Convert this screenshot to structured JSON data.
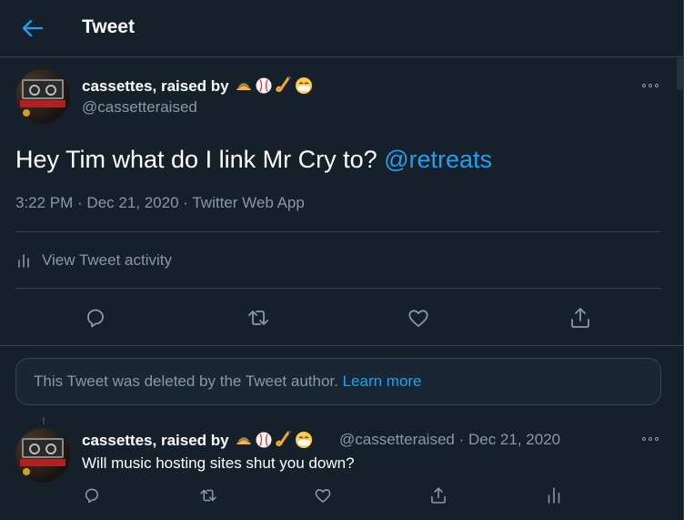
{
  "header": {
    "title": "Tweet"
  },
  "main_tweet": {
    "author_name": "cassettes, raised by",
    "author_emojis": [
      "taco-emoji",
      "baseball-emoji",
      "saxophone-emoji",
      "mask-face-emoji"
    ],
    "handle": "@cassetteraised",
    "text": "Hey Tim what do I link Mr Cry to? ",
    "mention": "@retreats",
    "meta": "3:22 PM · Dec 21, 2020 · Twitter Web App",
    "activity_label": "View Tweet activity"
  },
  "deleted_notice": {
    "text": "This Tweet was deleted by the Tweet author. ",
    "link": "Learn more"
  },
  "reply_tweet": {
    "author_name": "cassettes, raised by",
    "handle_and_date": "@cassetteraised · Dec 21, 2020",
    "text": "Will music hosting sites shut you down?"
  },
  "colors": {
    "background": "#15202b",
    "accent": "#1da1f2",
    "muted": "#8899a6",
    "border": "#38444d"
  }
}
